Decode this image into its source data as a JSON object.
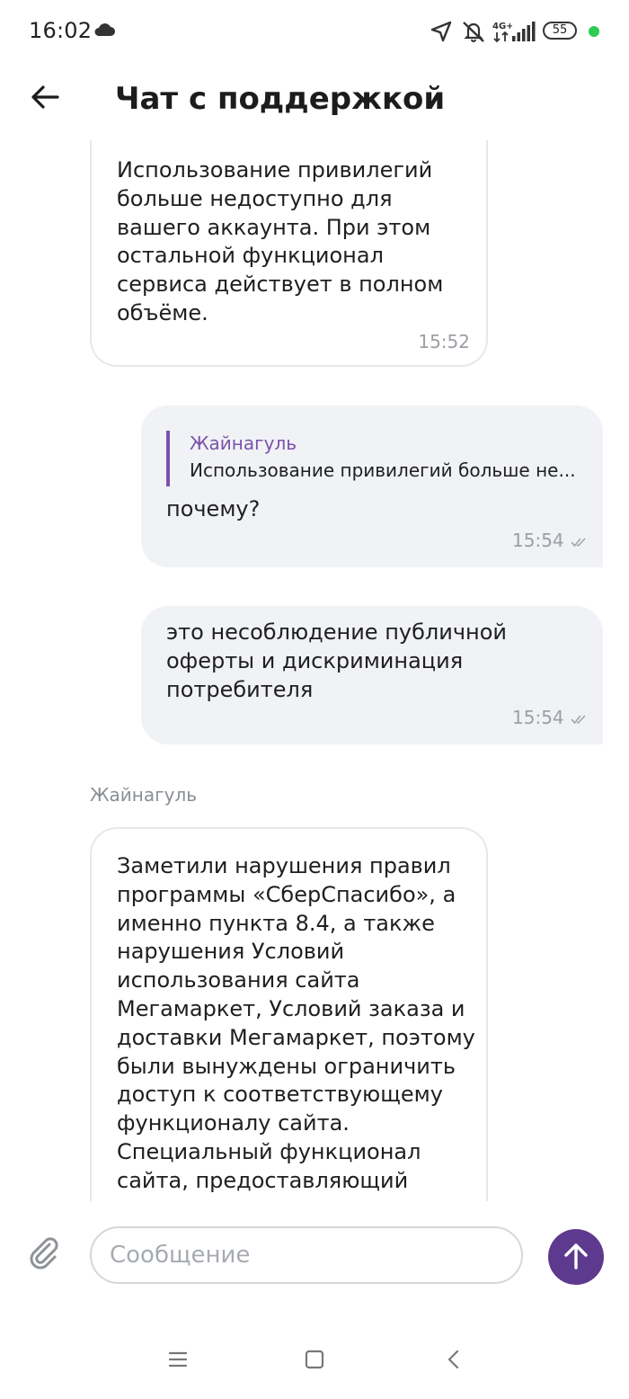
{
  "status_bar": {
    "time": "16:02",
    "battery": "55",
    "network": "4G+",
    "icons": [
      "cloud-icon",
      "location-icon",
      "mute-icon",
      "network-4g-icon",
      "signal-icon",
      "battery-icon"
    ]
  },
  "header": {
    "title": "Чат с поддержкой",
    "back_icon": "arrow-left-icon"
  },
  "messages": [
    {
      "direction": "incoming",
      "text": "Использование привилегий\nбольше недоступно для\nвашего аккаунта. При этом\nостальной функционал\nсервиса действует в полном\nобъёме.",
      "time": "15:52"
    },
    {
      "direction": "outgoing",
      "reply_to": {
        "author": "Жайнагуль",
        "text": "Использование привилегий больше не..."
      },
      "text": "почему?",
      "time": "15:54",
      "status": "read"
    },
    {
      "direction": "outgoing",
      "text": "это несоблюдение публичной\nоферты и дискриминация\nпотребителя",
      "time": "15:54",
      "status": "read"
    },
    {
      "direction": "incoming",
      "sender": "Жайнагуль",
      "text": "Заметили нарушения правил\nпрограммы «СберСпасибо», а\nименно пункта 8.4, а также\nнарушения Условий\nиспользования сайта\nМегамаркет, Условий заказа и\nдоставки Мегамаркет, поэтому\nбыли вынуждены ограничить\nдоступ к соответствующему\nфункционалу сайта.\nСпециальный функционал\nсайта, предоставляющий"
    }
  ],
  "composer": {
    "placeholder": "Сообщение",
    "value": "",
    "attach_icon": "paperclip-icon",
    "send_icon": "arrow-up-icon"
  },
  "colors": {
    "accent": "#5e3a8e",
    "quote_accent": "#7b52ab",
    "outgoing_bubble": "#f0f2f5",
    "incoming_border": "#e6e8ec",
    "time_text": "#9aa0a6",
    "online_dot": "#2ecc52"
  },
  "nav_bar": {
    "icons": [
      "menu-icon",
      "home-square-icon",
      "back-chevron-icon"
    ]
  }
}
